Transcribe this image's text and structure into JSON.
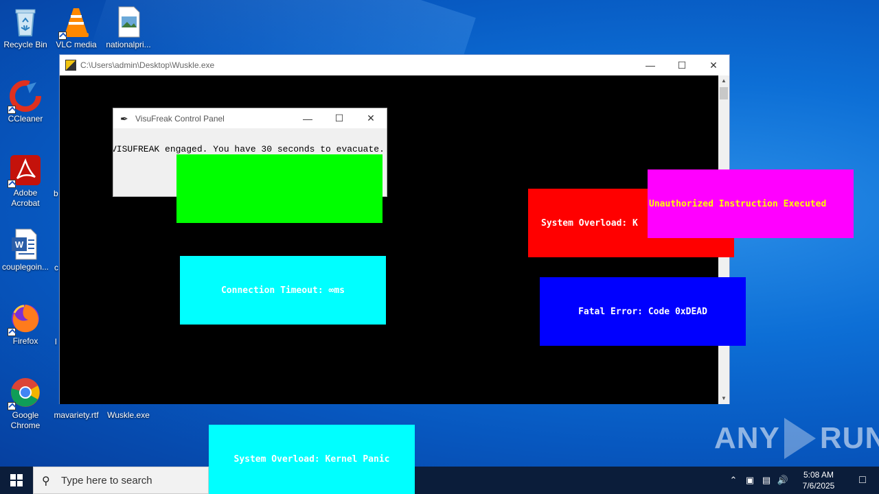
{
  "desktop": {
    "icons": [
      {
        "label": "Recycle Bin",
        "icon": "recycle-bin-icon"
      },
      {
        "label": "VLC media",
        "icon": "vlc-icon"
      },
      {
        "label": "nationalpri...",
        "icon": "image-file-icon"
      },
      {
        "label": "CCleaner",
        "icon": "ccleaner-icon"
      },
      {
        "label": "Adobe Acrobat",
        "icon": "acrobat-icon"
      },
      {
        "label": "couplegoin...",
        "icon": "word-doc-icon"
      },
      {
        "label": "Firefox",
        "icon": "firefox-icon"
      },
      {
        "label": "Google Chrome",
        "icon": "chrome-icon"
      },
      {
        "label": "mavariety.rtf",
        "icon": "rtf-file-icon"
      },
      {
        "label": "Wuskle.exe",
        "icon": "exe-file-icon"
      }
    ],
    "partial_labels": [
      "b",
      "c",
      "l"
    ]
  },
  "console": {
    "title": "C:\\Users\\admin\\Desktop\\Wuskle.exe"
  },
  "panel": {
    "title": "VisuFreak Control Panel",
    "message": "VISUFREAK engaged. You have 30 seconds to evacuate."
  },
  "alerts": {
    "green": "",
    "red": "System Overload: K",
    "magenta": "Unauthorized Instruction Executed",
    "cyan1": "Connection Timeout: ∞ms",
    "blue": "Fatal Error: Code 0xDEAD",
    "cyan2": "System Overload: Kernel Panic"
  },
  "alert_colors": {
    "green": "#00ff00",
    "red": "#ff0000",
    "magenta": "#ff00ff",
    "cyan": "#00ffff",
    "blue": "#0000ff",
    "magenta_text": "#ffff00"
  },
  "watermark": {
    "left": "ANY",
    "right": "RUN"
  },
  "taskbar": {
    "search_placeholder": "Type here to search",
    "time": "5:08 AM",
    "date": "7/6/2025"
  }
}
